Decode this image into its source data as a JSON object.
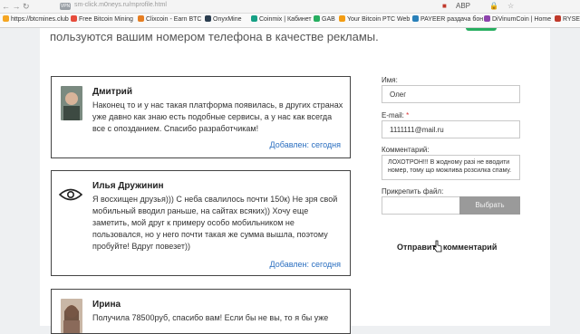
{
  "browser": {
    "url": "sm-click.m0neys.ru/mprofile.html",
    "nav_icons": "← → ↻",
    "extension_labels": [
      "ABP",
      "🔒",
      "☆"
    ]
  },
  "bookmarks": [
    {
      "label": "https://btcmines.club",
      "color": "#f5a623"
    },
    {
      "label": "Free Bitcoin Mining",
      "color": "#e74c3c"
    },
    {
      "label": "Clixcoin - Earn BTC",
      "color": "#e67e22"
    },
    {
      "label": "OnyxMine",
      "color": "#2c3e50"
    },
    {
      "label": "Coinmix | Кабинет",
      "color": "#16a085"
    },
    {
      "label": "GAB",
      "color": "#27ae60"
    },
    {
      "label": "Your Bitcoin PTC Web",
      "color": "#f39c12"
    },
    {
      "label": "PAYEER раздача бон",
      "color": "#2980b9"
    },
    {
      "label": "DiVinumCoin | Home",
      "color": "#8e44ad"
    },
    {
      "label": "RYSE",
      "color": "#c0392b"
    }
  ],
  "intro_text": "пользуются вашим номером телефона в качестве рекламы.",
  "comments": [
    {
      "name": "Дмитрий",
      "text": "Наконец то и у нас такая платформа появилась, в других странах уже давно как знаю есть подобные сервисы, а у нас как всегда все с опозданием. Спасибо разработчикам!",
      "meta": "Добавлен: сегодня"
    },
    {
      "name": "Илья Дружинин",
      "text": "Я восхищен друзья))) С неба свалилось почти 150к) Не зря свой мобильный вводил раньше, на сайтах всяких)) Хочу еще заметить, мой друг к примеру особо мобильником не пользовался, но у него почти такая же сумма вышла, поэтому пробуйте! Вдруг повезет))",
      "meta": "Добавлен: сегодня"
    },
    {
      "name": "Ирина",
      "text": "Получила 78500руб, спасибо вам! Если бы не вы, то я бы уже"
    }
  ],
  "form": {
    "name_label": "Имя:",
    "name_value": "Олег",
    "email_label": "E-mail:",
    "email_required": "*",
    "email_value": "1111111@mail.ru",
    "comment_label": "Комментарий:",
    "comment_value": "ЛОХОТРОН!!! В жодному разі не вводити номер, тому що можлива розсилка спаму.",
    "file_label": "Прикрепить файл:",
    "file_button": "Выбрать",
    "submit": "Отправить комментарий"
  }
}
